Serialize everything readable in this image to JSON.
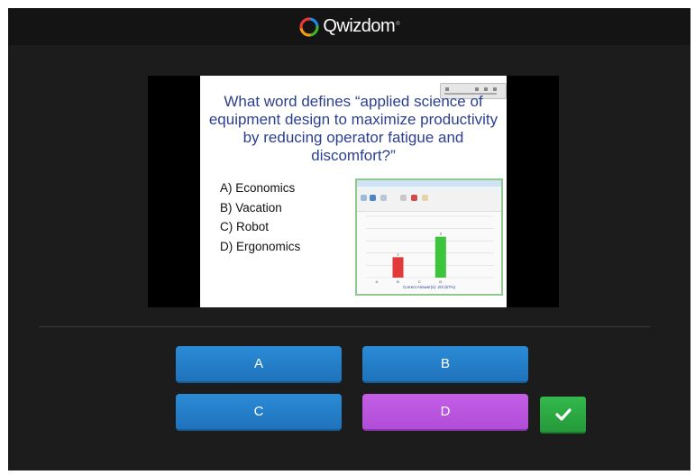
{
  "header": {
    "logo_text": "Qwizdom",
    "logo_tm": "®"
  },
  "slide": {
    "question": "What word defines “applied science of equipment design to maximize productivity by reducing operator fatigue and discomfort?”",
    "answers": [
      "A) Economics",
      "B) Vacation",
      "C) Robot",
      "D) Ergonomics"
    ],
    "results_caption": "Correct Answer(s): 2/3 (67%)"
  },
  "chart_data": {
    "type": "bar",
    "categories": [
      "A",
      "B",
      "C",
      "D",
      "",
      ""
    ],
    "values": [
      0,
      1,
      0,
      2,
      0,
      0
    ],
    "title": "",
    "colors": [
      "#e23a3a",
      "#e23a3a",
      "#e23a3a",
      "#3cc43c",
      "#e23a3a",
      "#e23a3a"
    ],
    "ylim": [
      0,
      3
    ],
    "grid": true,
    "caption": "Correct Answer(s): 2/3 (67%)"
  },
  "choices": {
    "a": "A",
    "b": "B",
    "c": "C",
    "d": "D"
  },
  "selected_choice": "D",
  "colors": {
    "background": "#1c1c1c",
    "header": "#141414",
    "button_blue": "#1f73bb",
    "button_selected": "#b14dd8",
    "submit_green": "#259a3a"
  },
  "icons": {
    "submit": "check-icon",
    "logo": "qwizdom-logo-icon"
  }
}
